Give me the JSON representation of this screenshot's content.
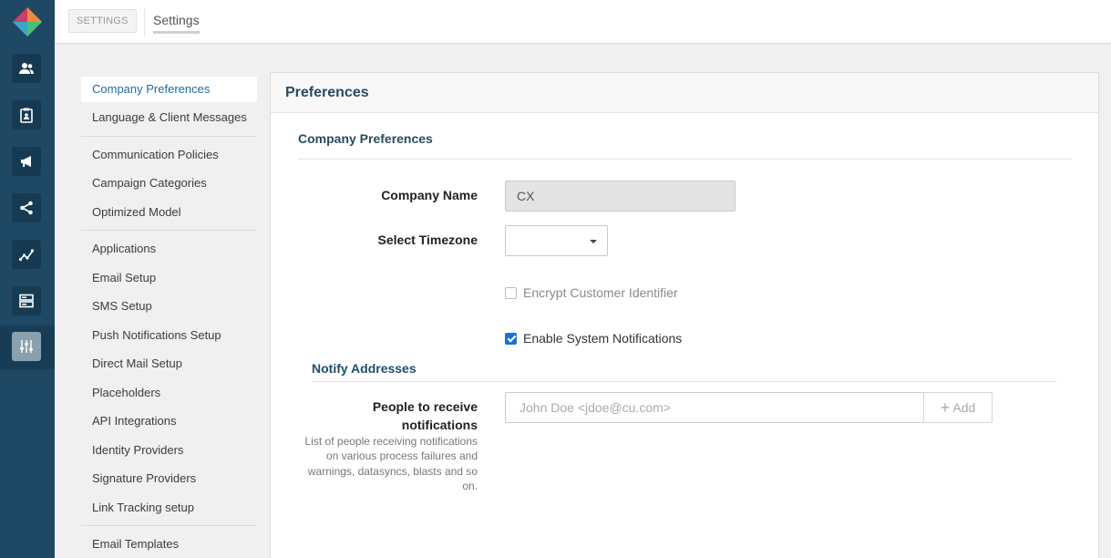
{
  "rail": {
    "icons": [
      "people-icon",
      "clipboard-icon",
      "megaphone-icon",
      "share-icon",
      "analytics-icon",
      "server-icon",
      "sliders-icon"
    ]
  },
  "topbar": {
    "badge": "SETTINGS",
    "title": "Settings"
  },
  "nav": {
    "groups": [
      [
        "Company Preferences",
        "Language & Client Messages"
      ],
      [
        "Communication Policies",
        "Campaign Categories",
        "Optimized Model"
      ],
      [
        "Applications",
        "Email Setup",
        "SMS Setup",
        "Push Notifications Setup",
        "Direct Mail Setup",
        "Placeholders",
        "API Integrations",
        "Identity Providers",
        "Signature Providers",
        "Link Tracking setup"
      ],
      [
        "Email Templates"
      ]
    ],
    "active": "Company Preferences"
  },
  "panel": {
    "title": "Preferences",
    "section_title": "Company Preferences",
    "company_name_label": "Company Name",
    "company_name_value": "CX",
    "timezone_label": "Select Timezone",
    "timezone_value": "",
    "encrypt_label": "Encrypt Customer Identifier",
    "encrypt_checked": false,
    "notifications_label": "Enable System Notifications",
    "notifications_checked": true,
    "notify_title": "Notify Addresses",
    "people_label": "People to receive notifications",
    "people_help": "List of people receiving notifications on various process failures and warnings, datasyncs, blasts and so on.",
    "people_placeholder": "John Doe <jdoe@cu.com>",
    "add_label": "Add"
  },
  "colors": {
    "rail": "#1e4864",
    "accent": "#1f6c9e",
    "heading": "#2b4a5e",
    "checkbox": "#1a73d6"
  }
}
